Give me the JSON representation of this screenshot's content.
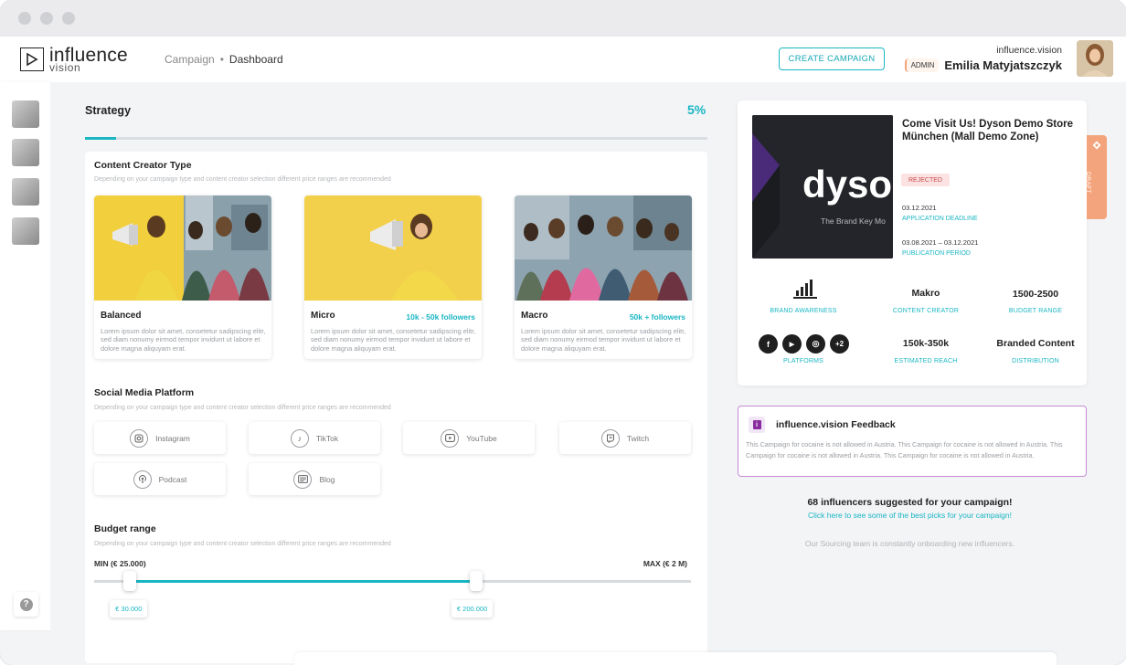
{
  "window": {
    "title_dots": [
      "close",
      "minimize",
      "maximize"
    ]
  },
  "header": {
    "logo_line1": "influence",
    "logo_line2": "vision",
    "breadcrumb": [
      "Campaign",
      "Dashboard"
    ],
    "create_button": "CREATE CAMPAIGN",
    "org": "influence.vision",
    "role_badge": "ADMIN",
    "user_name": "Emilia Matyjatszczyk"
  },
  "main": {
    "section_title": "Strategy",
    "progress_label": "5%",
    "progress_value": 0.05,
    "content_creator": {
      "title": "Content Creator Type",
      "subtitle": "Depending on your campaign type and content creator selection different price ranges are recommended",
      "cards": [
        {
          "title": "Balanced",
          "followers": "",
          "desc": "Lorem ipsum dolor sit amet, consetetur sadipscing elitr, sed diam nonumy eirmod tempor invidunt ut labore et dolore magna aliquyam erat."
        },
        {
          "title": "Micro",
          "followers": "10k - 50k followers",
          "desc": "Lorem ipsum dolor sit amet, consetetur sadipscing elitr, sed diam nonumy eirmod tempor invidunt ut labore et dolore magna aliquyam erat."
        },
        {
          "title": "Macro",
          "followers": "50k + followers",
          "desc": "Lorem ipsum dolor sit amet, consetetur sadipscing elitr, sed diam nonumy eirmod tempor invidunt ut labore et dolore magna aliquyam erat."
        }
      ]
    },
    "social_media": {
      "title": "Social Media Platform",
      "subtitle": "Depending on your campaign type and content creator selection different price ranges are recommended",
      "platforms": [
        "Instagram",
        "TikTok",
        "YouTube",
        "Twitch",
        "Podcast",
        "Blog"
      ]
    },
    "budget": {
      "title": "Budget range",
      "subtitle": "Depending on your campaign type and content creator selection different price ranges are recommended",
      "min_label": "MIN (€ 25.000)",
      "max_label": "MAX (€ 2 M)",
      "low_value": "€ 30.000",
      "high_value": "€ 200.000",
      "low_fraction": 0.06,
      "high_fraction": 0.64
    }
  },
  "campaign": {
    "title": "Come Visit Us! Dyson Demo Store München (Mall Demo Zone)",
    "status": "REJECTED",
    "draft_label": "DRAFT",
    "image_brand": "dyso",
    "image_tagline": "The Brand Key Mo",
    "deadline_date": "03.12.2021",
    "deadline_label": "APPLICATION DEADLINE",
    "period_date": "03.08.2021 – 03.12.2021",
    "period_label": "PUBLICATION PERIOD",
    "stats": [
      {
        "value": "",
        "label": "BRAND AWARENESS"
      },
      {
        "value": "Makro",
        "label": "CONTENT CREATOR"
      },
      {
        "value": "1500-2500",
        "label": "BUDGET RANGE"
      },
      {
        "value": "",
        "label": "PLATFORMS"
      },
      {
        "value": "150k-350k",
        "label": "ESTIMATED REACH"
      },
      {
        "value": "Branded Content",
        "label": "DISTRIBUTION"
      }
    ],
    "platform_icons": [
      "f",
      "▶",
      "◎",
      "+2"
    ]
  },
  "feedback": {
    "title": "influence.vision Feedback",
    "text": "This Campaign for cocaine is not allowed in Austria. This Campaign for cocaine is not allowed in Austria. This Campaign for cocaine is not allowed in Austria. This Campaign for cocaine is not allowed in Austria."
  },
  "suggestions": {
    "headline": "68 influencers suggested for your campaign!",
    "link": "Click here to see some of the best picks for your campaign!",
    "note": "Our Sourcing team is constantly onboarding new influencers."
  },
  "colors": {
    "accent": "#1ab6c4",
    "draft": "#f4a47c",
    "feedback_border": "#c58ad6",
    "rejected_bg": "#fbe3e3"
  }
}
